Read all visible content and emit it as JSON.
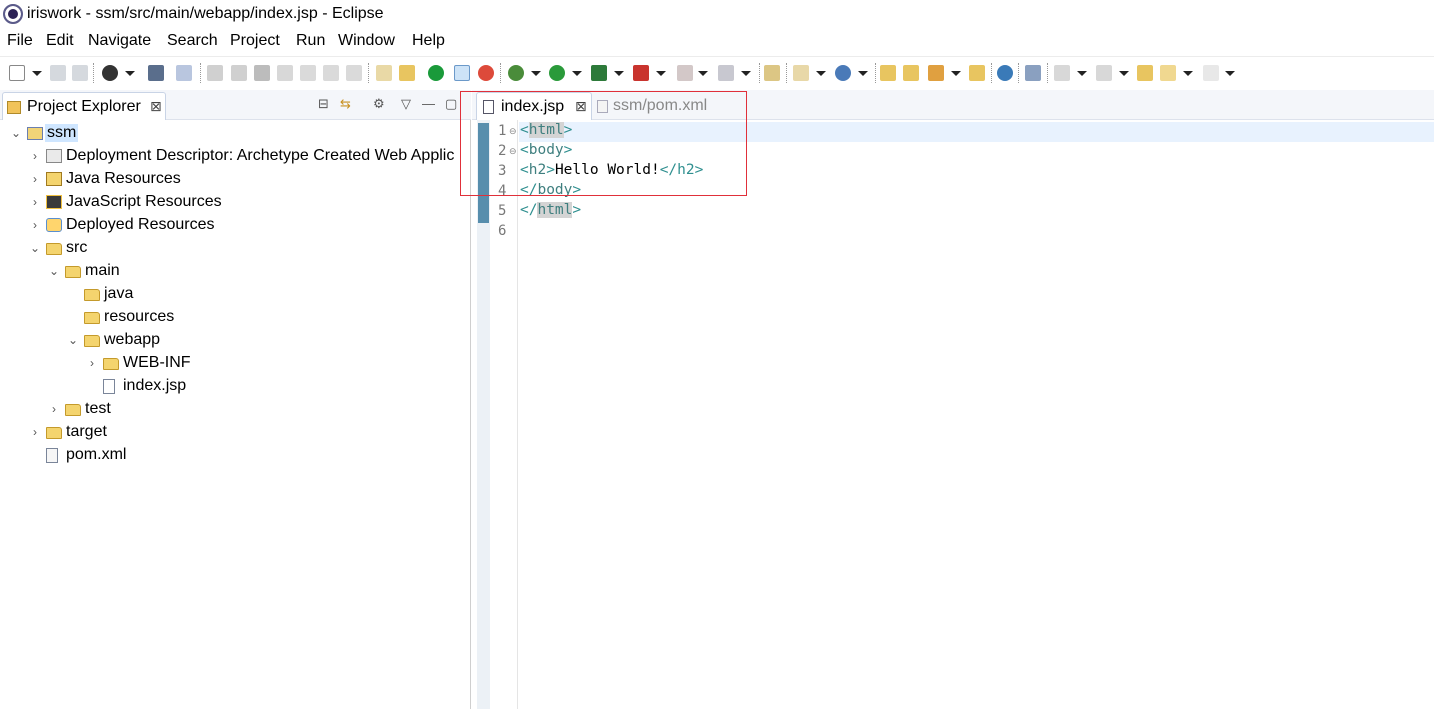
{
  "window": {
    "title": "iriswork - ssm/src/main/webapp/index.jsp - Eclipse"
  },
  "menu": [
    "File",
    "Edit",
    "Navigate",
    "Search",
    "Project",
    "Run",
    "Window",
    "Help"
  ],
  "explorer": {
    "title": "Project Explorer",
    "close_glyph": "⊠",
    "view_buttons": [
      "⊟",
      "⇆",
      "⚙",
      "▽",
      "—",
      "▢"
    ],
    "tree": [
      {
        "label": "ssm",
        "depth": 0,
        "expanded": true,
        "selected": true,
        "icon": "project-icon"
      },
      {
        "label": "Deployment Descriptor: Archetype Created Web Applic",
        "depth": 1,
        "expanded": false,
        "icon": "deployment-descriptor-icon"
      },
      {
        "label": "Java Resources",
        "depth": 1,
        "expanded": false,
        "icon": "java-resources-icon"
      },
      {
        "label": "JavaScript Resources",
        "depth": 1,
        "expanded": false,
        "icon": "javascript-resources-icon"
      },
      {
        "label": "Deployed Resources",
        "depth": 1,
        "expanded": false,
        "icon": "deployed-resources-icon"
      },
      {
        "label": "src",
        "depth": 1,
        "expanded": true,
        "icon": "folder-icon"
      },
      {
        "label": "main",
        "depth": 2,
        "expanded": true,
        "icon": "folder-icon"
      },
      {
        "label": "java",
        "depth": 3,
        "expanded": null,
        "icon": "folder-icon"
      },
      {
        "label": "resources",
        "depth": 3,
        "expanded": null,
        "icon": "folder-icon"
      },
      {
        "label": "webapp",
        "depth": 3,
        "expanded": true,
        "icon": "folder-icon"
      },
      {
        "label": "WEB-INF",
        "depth": 4,
        "expanded": false,
        "icon": "folder-icon"
      },
      {
        "label": "index.jsp",
        "depth": 4,
        "expanded": null,
        "icon": "jsp-file-icon"
      },
      {
        "label": "test",
        "depth": 2,
        "expanded": false,
        "icon": "folder-icon"
      },
      {
        "label": "target",
        "depth": 1,
        "expanded": false,
        "icon": "folder-icon"
      },
      {
        "label": "pom.xml",
        "depth": 1,
        "expanded": null,
        "icon": "maven-pom-icon"
      }
    ]
  },
  "editor": {
    "tabs": [
      {
        "label": "index.jsp",
        "active": true,
        "close_glyph": "⊠"
      },
      {
        "label": "ssm/pom.xml",
        "active": false
      }
    ],
    "line_numbers": [
      "1",
      "2",
      "3",
      "4",
      "5",
      "6"
    ],
    "fold_marks": [
      "⊖",
      "⊖"
    ],
    "lines": [
      {
        "open": "<",
        "name": "html",
        "close": ">",
        "text": ""
      },
      {
        "open": "<",
        "name": "body",
        "close": ">",
        "text": ""
      },
      {
        "open": "<",
        "name": "h2",
        "close": ">",
        "text": "Hello World!",
        "end": "</h2>"
      },
      {
        "open": "</",
        "name": "body",
        "close": ">",
        "text": ""
      },
      {
        "open": "</",
        "name": "html",
        "close": ">",
        "text": ""
      }
    ]
  },
  "colors": {
    "accent": "#3d7ca0",
    "annotation_box": "#e0303a",
    "selection": "#cfe6ff"
  }
}
